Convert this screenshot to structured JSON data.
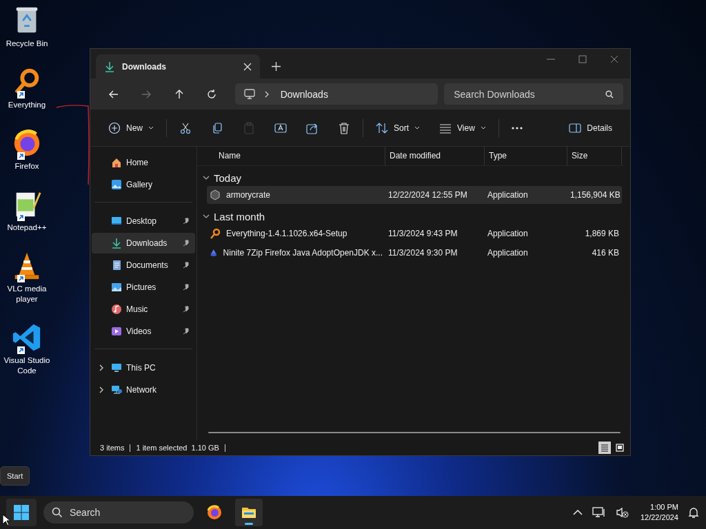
{
  "desktop_icons": [
    {
      "label": "Recycle Bin",
      "kind": "recycle",
      "shortcut": false
    },
    {
      "label": "Everything",
      "kind": "everything",
      "shortcut": true
    },
    {
      "label": "Firefox",
      "kind": "firefox",
      "shortcut": true
    },
    {
      "label": "Notepad++",
      "kind": "notepad",
      "shortcut": true
    },
    {
      "label": "VLC media player",
      "kind": "vlc",
      "shortcut": true
    },
    {
      "label": "Visual Studio Code",
      "kind": "vscode",
      "shortcut": true
    }
  ],
  "window": {
    "tab": {
      "title": "Downloads"
    },
    "nav_buttons": [
      {
        "kind": "back",
        "disabled": false
      },
      {
        "kind": "forward",
        "disabled": true
      },
      {
        "kind": "up",
        "disabled": false
      },
      {
        "kind": "refresh",
        "disabled": false
      }
    ],
    "address": {
      "path": "Downloads"
    },
    "search": {
      "placeholder": "Search Downloads"
    },
    "toolbar": [
      {
        "kind": "new",
        "label": "New",
        "disabled": false
      },
      {
        "kind": "cut",
        "disabled": false
      },
      {
        "kind": "copy",
        "disabled": false
      },
      {
        "kind": "paste",
        "disabled": true
      },
      {
        "kind": "rename",
        "disabled": false
      },
      {
        "kind": "share",
        "disabled": false
      },
      {
        "kind": "delete",
        "disabled": false
      },
      {
        "kind": "sort",
        "label": "Sort",
        "disabled": false
      },
      {
        "kind": "view",
        "label": "View",
        "disabled": false
      },
      {
        "kind": "more",
        "disabled": false
      },
      {
        "kind": "details",
        "label": "Details",
        "disabled": false
      }
    ],
    "sidebar": {
      "groups": [
        [
          {
            "label": "Home",
            "kind": "home",
            "pinned": false,
            "selected": false
          },
          {
            "label": "Gallery",
            "kind": "gallery",
            "pinned": false,
            "selected": false
          }
        ],
        [
          {
            "label": "Desktop",
            "kind": "desktop",
            "pinned": true,
            "selected": false
          },
          {
            "label": "Downloads",
            "kind": "downloads",
            "pinned": true,
            "selected": true
          },
          {
            "label": "Documents",
            "kind": "documents",
            "pinned": true,
            "selected": false
          },
          {
            "label": "Pictures",
            "kind": "pictures",
            "pinned": true,
            "selected": false
          },
          {
            "label": "Music",
            "kind": "music",
            "pinned": true,
            "selected": false
          },
          {
            "label": "Videos",
            "kind": "videos",
            "pinned": true,
            "selected": false
          }
        ],
        [
          {
            "label": "This PC",
            "kind": "pc",
            "expanded": false,
            "selected": false
          },
          {
            "label": "Network",
            "kind": "network",
            "expanded": false,
            "selected": false
          }
        ]
      ]
    },
    "table": {
      "columns": [
        "Name",
        "Date modified",
        "Type",
        "Size"
      ],
      "groups": [
        {
          "label": "Today",
          "expanded": true,
          "rows": [
            {
              "kind": "armory",
              "name": "armorycrate",
              "date": "12/22/2024 12:55 PM",
              "type": "Application",
              "size": "1,156,904 KB",
              "selected": true
            }
          ]
        },
        {
          "label": "Last month",
          "expanded": true,
          "rows": [
            {
              "kind": "everything",
              "name": "Everything-1.4.1.1026.x64-Setup",
              "date": "11/3/2024 9:43 PM",
              "type": "Application",
              "size": "1,869 KB",
              "selected": false
            },
            {
              "kind": "ninite",
              "name": "Ninite 7Zip Firefox Java AdoptOpenJDK x...",
              "date": "11/3/2024 9:30 PM",
              "type": "Application",
              "size": "416 KB",
              "selected": false
            }
          ]
        }
      ]
    },
    "status_bar": {
      "items": [
        "3 items",
        "1 item selected  1.10 GB"
      ],
      "views": [
        {
          "kind": "details",
          "selected": true
        },
        {
          "kind": "tiles",
          "selected": false
        }
      ]
    }
  },
  "start_tooltip": "Start",
  "taskbar": {
    "search": {
      "placeholder": "Search"
    },
    "apps": [
      {
        "kind": "firefox",
        "active": false
      },
      {
        "kind": "explorer",
        "active": true
      }
    ],
    "clock": {
      "time": "1:00 PM",
      "date": "12/22/2024"
    }
  }
}
